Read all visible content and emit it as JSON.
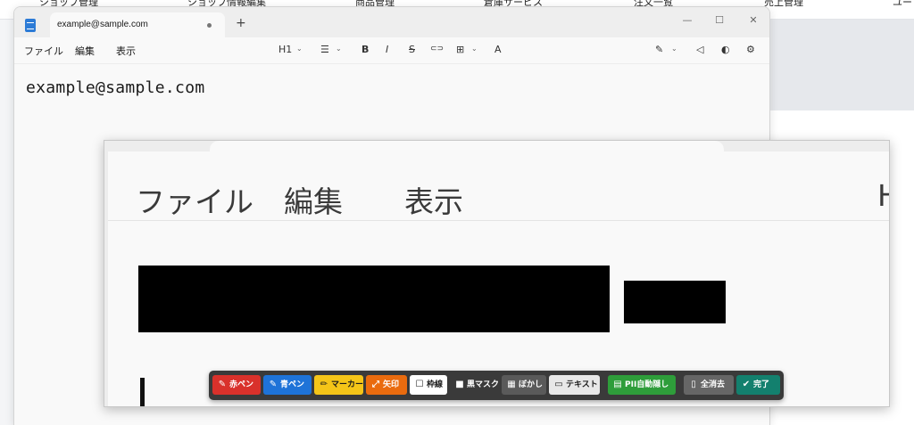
{
  "background_app": {
    "nav_items": [
      "ショップ管理",
      "ショップ情報編集",
      "商品管理",
      "倉庫サービス",
      "注文一覧",
      "売上管理",
      "ユー"
    ]
  },
  "notepad": {
    "tab_title": "example@sample.com",
    "new_tab_label": "+",
    "window_controls": {
      "minimize": "—",
      "maximize": "☐",
      "close": "✕"
    },
    "menu": {
      "file": "ファイル",
      "edit": "編集",
      "view": "表示"
    },
    "toolbar": {
      "heading": "H1",
      "list": "☰",
      "bold": "B",
      "italic": "I",
      "strikethrough": "S",
      "link": "⊂⊃",
      "table": "⊞",
      "spellcheck": "A"
    },
    "right_icons": {
      "copilot": "✎",
      "announce": "◁",
      "avatar": "◐",
      "settings": "⚙"
    },
    "editor_text": "example@sample.com"
  },
  "capture_overlay": {
    "menu": {
      "file": "ファイル",
      "edit": "編集",
      "view": "表示"
    },
    "partial_heading": "H"
  },
  "annotation_toolbar": {
    "buttons": [
      {
        "label": "赤ペン",
        "icon": "pen-icon",
        "color": "#d9312b"
      },
      {
        "label": "青ペン",
        "icon": "pen-icon",
        "color": "#1e73d8"
      },
      {
        "label": "マーカー",
        "icon": "marker-icon",
        "color": "#f5c518"
      },
      {
        "label": "矢印",
        "icon": "arrow-icon",
        "color": "#ea6b0e"
      },
      {
        "label": "枠線",
        "icon": "frame-icon",
        "color": "#ffffff"
      },
      {
        "label": "黒マスク",
        "icon": "black-mask-icon",
        "color": "#3a3a3a"
      },
      {
        "label": "ぼかし",
        "icon": "blur-icon",
        "color": "#5a5a5a"
      },
      {
        "label": "テキスト",
        "icon": "text-icon",
        "color": "#e8e8e8"
      },
      {
        "label": "PII自動隠し",
        "icon": "pii-icon",
        "color": "#2e9d3a"
      },
      {
        "label": "全消去",
        "icon": "trash-icon",
        "color": "#666666"
      },
      {
        "label": "完了",
        "icon": "check-icon",
        "color": "#13806e"
      }
    ]
  }
}
